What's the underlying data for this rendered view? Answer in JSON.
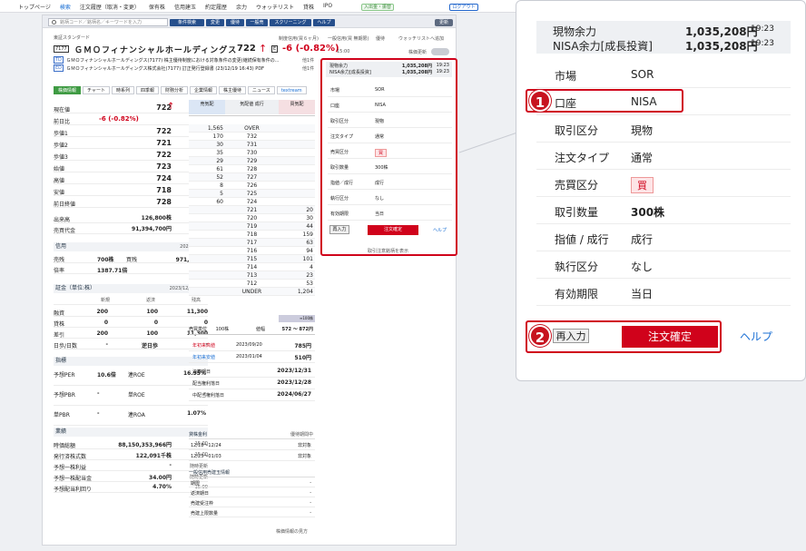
{
  "topnav": {
    "items": [
      "トップページ",
      "検索",
      "注文履歴（取消・変更）",
      "保有株",
      "信用建玉",
      "約定履歴",
      "余力",
      "ウォッチリスト",
      "貸株",
      "IPO"
    ],
    "deposit": "入出金・振替",
    "logout": "ログアウト"
  },
  "toolbar": {
    "search_placeholder": "銘柄コード／銘柄名／キーワードを入力",
    "buttons": [
      "条件検索",
      "変更",
      "優待",
      "一般売",
      "スクリーニング",
      "ヘルプ"
    ],
    "refresh": "更新"
  },
  "stock": {
    "market": "東証スタンダード",
    "code": "7177",
    "name": "ＧＭＯフィナンシャルホールディングス",
    "price": "722",
    "badge": "E",
    "change": "-6 (-0.82%)",
    "links": [
      "制度信用(買６ヶ月)",
      "一般信用(買 無期限)",
      "優待"
    ],
    "watch": "ウォッチリストへ追加",
    "time": "15:00",
    "auto": "株価更新"
  },
  "news": [
    {
      "tag": "TD",
      "text": "ＧＭＯフィナンシャルホールディングス(7177) 株主優待制度における対象条件の変更(継続保有条件の...",
      "date": "他1件"
    },
    {
      "tag": "ED",
      "text": "ＧＭＯフィナンシャルホールディングス株式会社(7177) 訂正発行登録書 (23/12/19 16:43) PDF",
      "date": "他1件"
    }
  ],
  "tabs": [
    "株価情報",
    "チャート",
    "時系列",
    "四季報",
    "財務分析",
    "企業情報",
    "株主優待",
    "ニュース",
    "textream"
  ],
  "quote": [
    {
      "k": "現在値",
      "v": "722",
      "t": "15:00"
    },
    {
      "k": "前日比",
      "v": "-6 (-0.82%)",
      "t": ""
    },
    {
      "k": "歩値1",
      "v": "722",
      "t": "14:59"
    },
    {
      "k": "歩値2",
      "v": "721",
      "t": "14:59"
    },
    {
      "k": "歩値3",
      "v": "722",
      "t": "14:58"
    },
    {
      "k": "始値",
      "v": "723",
      "t": "09:00"
    },
    {
      "k": "高値",
      "v": "724",
      "t": "09:01"
    },
    {
      "k": "安値",
      "v": "718",
      "t": "10:32"
    },
    {
      "k": "前日終値",
      "v": "728",
      "t": "12/20"
    },
    {
      "k": "出来高",
      "v": "126,800株",
      "t": ""
    },
    {
      "k": "売買代金",
      "v": "91,394,700円",
      "t": ""
    }
  ],
  "margin": {
    "title": "信用",
    "date": "2023/12/15",
    "sell_k": "売残",
    "sell_v": "700株",
    "buy_k": "買残",
    "buy_v": "971,400株",
    "ratio_k": "倍率",
    "ratio_v": "1387.71倍"
  },
  "shoukin": {
    "title": "証金（単位:株）",
    "date": "2023/12/20 確報",
    "cols": [
      "新規",
      "返済",
      "残高"
    ],
    "rows": [
      [
        "融資",
        "200",
        "100",
        "11,300"
      ],
      [
        "貸株",
        "0",
        "0",
        "0"
      ],
      [
        "差引",
        "200",
        "100",
        "11,300"
      ],
      [
        "日歩/日数",
        "-",
        "逆日歩",
        "-"
      ]
    ]
  },
  "indicators": {
    "title": "指標",
    "rows": [
      [
        "予想PER",
        "10.6倍",
        "連ROE",
        "16.95%"
      ],
      [
        "予想PBR",
        "-",
        "単ROE",
        "-"
      ],
      [
        "単PBR",
        "-",
        "連ROA",
        "1.07%"
      ]
    ]
  },
  "perf": {
    "title": "業績",
    "rows": [
      [
        "時価総額",
        "88,150,353,966円",
        "15:00"
      ],
      [
        "発行済株式数",
        "122,091千株",
        "15:00"
      ],
      [
        "予想一株利益",
        "-",
        "随時更新"
      ],
      [
        "予想一株配当金",
        "34.00円",
        "随時更新"
      ],
      [
        "予想配当利回り",
        "4.70%",
        "15:00"
      ]
    ]
  },
  "board": {
    "headers": [
      "売気配",
      "気配値\n成行",
      "買気配"
    ],
    "asks": [
      [
        "",
        "OVER"
      ],
      [
        "1,565",
        ""
      ],
      [
        "170",
        "732"
      ],
      [
        "30",
        "731"
      ],
      [
        "35",
        "730"
      ],
      [
        "29",
        "729"
      ],
      [
        "61",
        "728"
      ],
      [
        "52",
        "727"
      ],
      [
        "8",
        "726"
      ],
      [
        "5",
        "725"
      ],
      [
        "60",
        "724"
      ]
    ],
    "ask_prices": [
      "OVER",
      "732",
      "731",
      "730",
      "729",
      "728",
      "727",
      "726",
      "725",
      "724"
    ],
    "ask_qty": [
      "1,565",
      "170",
      "30",
      "35",
      "29",
      "61",
      "52",
      "8",
      "5",
      "60"
    ],
    "bid_prices": [
      "721",
      "720",
      "719",
      "718",
      "717",
      "716",
      "715",
      "714",
      "713",
      "712",
      "UNDER"
    ],
    "bid_qty": [
      "20",
      "30",
      "44",
      "159",
      "63",
      "94",
      "101",
      "4",
      "23",
      "53",
      "1,204"
    ],
    "unit_k": "売買単位",
    "unit_v": "100株",
    "range_k": "値幅",
    "range_v": "572 〜 872円",
    "fold": "≡100株"
  },
  "ytd": {
    "high_k": "年初来高値",
    "high_d": "2023/09/20",
    "high_v": "785円",
    "low_k": "年初来安値",
    "low_d": "2023/01/04",
    "low_v": "510円"
  },
  "dates": [
    [
      "決算期日",
      "2023/12/31"
    ],
    [
      "配当権利落日",
      "2023/12/28"
    ],
    [
      "中配当権利落日",
      "2024/06/27"
    ]
  ],
  "lend": {
    "title": "貸株金利",
    "note": "優待期間中",
    "rows": [
      [
        "12/18〜12/24",
        "非対象"
      ],
      [
        "12/25〜01/03",
        "非対象"
      ]
    ]
  },
  "general": {
    "title": "一般信用売建玉情報",
    "rows": [
      [
        "期限",
        "-"
      ],
      [
        "返済期日",
        "-"
      ],
      [
        "売建受注枠",
        "-"
      ],
      [
        "売建上限数量",
        "-"
      ]
    ]
  },
  "guide": "株価情報の見方",
  "order": {
    "balance_k": "現物余力",
    "balance_v": "1,035,208円",
    "balance_t": "19:23",
    "nisa_k": "NISA余力[成長投資]",
    "nisa_v": "1,035,208円",
    "nisa_t": "19:23",
    "rows": [
      [
        "市場",
        "SOR"
      ],
      [
        "口座",
        "NISA"
      ],
      [
        "取引区分",
        "現物"
      ],
      [
        "注文タイプ",
        "通常"
      ],
      [
        "売買区分",
        "買"
      ],
      [
        "取引数量",
        "300株"
      ],
      [
        "指値／成行",
        "成行"
      ],
      [
        "執行区分",
        "なし"
      ],
      [
        "有効期限",
        "当日"
      ]
    ],
    "reinput": "再入力",
    "confirm": "注文確定",
    "help": "ヘルプ",
    "note": "取引注意銘柄を表示"
  },
  "zoom": {
    "balance_k": "現物余力",
    "balance_v": "1,035,208円",
    "balance_t": "19:23",
    "nisa_k": "NISA余力[成長投資]",
    "nisa_v": "1,035,208円",
    "nisa_t": "19:23",
    "rows": [
      [
        "市場",
        "SOR"
      ],
      [
        "口座",
        "NISA"
      ],
      [
        "取引区分",
        "現物"
      ],
      [
        "注文タイプ",
        "通常"
      ],
      [
        "売買区分",
        "買"
      ],
      [
        "取引数量",
        "300株"
      ],
      [
        "指値 / 成行",
        "成行"
      ],
      [
        "執行区分",
        "なし"
      ],
      [
        "有効期限",
        "当日"
      ]
    ],
    "reinput": "再入力",
    "confirm": "注文確定",
    "help": "ヘルプ",
    "step1": "1",
    "step2": "2"
  }
}
